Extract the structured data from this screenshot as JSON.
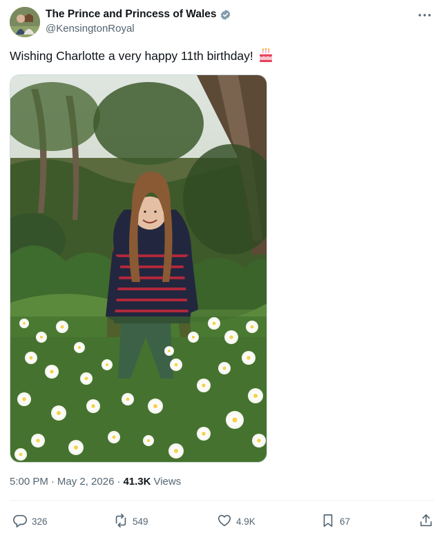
{
  "account": {
    "display_name": "The Prince and Princess of Wales",
    "handle": "@KensingtonRoyal"
  },
  "tweet": {
    "text": "Wishing Charlotte a very happy 11th birthday!",
    "emoji_icon": "birthday-cake-icon"
  },
  "meta": {
    "time": "5:00 PM",
    "separator": "·",
    "date": "May 2, 2026",
    "separator2": "·",
    "views_count": "41.3K",
    "views_label": "Views"
  },
  "actions": {
    "replies": "326",
    "reposts": "549",
    "likes": "4.9K",
    "bookmarks": "67"
  },
  "colors": {
    "text_primary": "#0f1419",
    "text_secondary": "#536471",
    "verified_blue": "#829aab",
    "border": "#cfd9de"
  }
}
